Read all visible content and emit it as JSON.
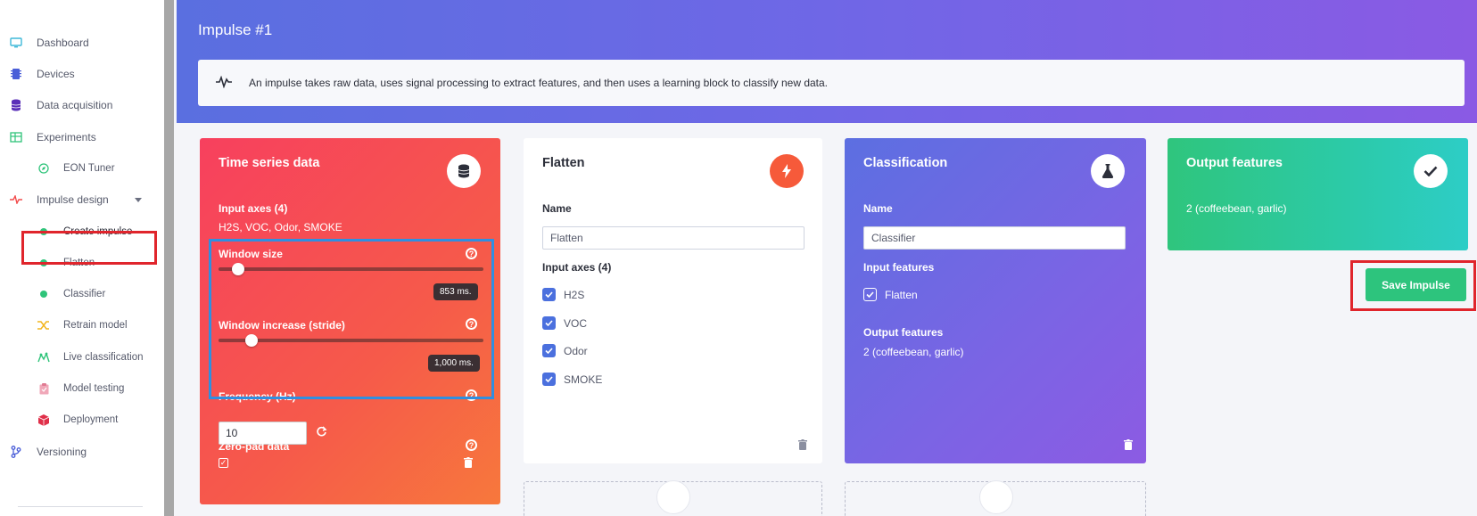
{
  "sidebar": {
    "items": [
      {
        "label": "Dashboard",
        "icon": "monitor-icon"
      },
      {
        "label": "Devices",
        "icon": "chip-icon"
      },
      {
        "label": "Data acquisition",
        "icon": "database-icon"
      },
      {
        "label": "Experiments",
        "icon": "table-icon"
      },
      {
        "label": "EON Tuner",
        "icon": "compass-icon"
      },
      {
        "label": "Impulse design",
        "icon": "pulse-icon"
      },
      {
        "label": "Create impulse",
        "icon": "dot-icon"
      },
      {
        "label": "Flatten",
        "icon": "dot-icon"
      },
      {
        "label": "Classifier",
        "icon": "dot-icon"
      },
      {
        "label": "Retrain model",
        "icon": "shuffle-icon"
      },
      {
        "label": "Live classification",
        "icon": "live-icon"
      },
      {
        "label": "Model testing",
        "icon": "clipboard-icon"
      },
      {
        "label": "Deployment",
        "icon": "cube-icon"
      },
      {
        "label": "Versioning",
        "icon": "branch-icon"
      }
    ]
  },
  "header": {
    "title": "Impulse #1",
    "info": "An impulse takes raw data, uses signal processing to extract features, and then uses a learning block to classify new data."
  },
  "time_series": {
    "title": "Time series data",
    "input_axes_label": "Input axes (4)",
    "input_axes_value": "H2S, VOC, Odor, SMOKE",
    "window_size_label": "Window size",
    "window_size_value": "853 ms.",
    "window_size_fraction": 0.05,
    "stride_label": "Window increase (stride)",
    "stride_value": "1,000 ms.",
    "stride_fraction": 0.1,
    "frequency_label": "Frequency (Hz)",
    "frequency_value": "10",
    "zero_pad_label": "Zero-pad data"
  },
  "flatten": {
    "title": "Flatten",
    "name_label": "Name",
    "name_value": "Flatten",
    "input_axes_label": "Input axes (4)",
    "axes": [
      "H2S",
      "VOC",
      "Odor",
      "SMOKE"
    ]
  },
  "classification": {
    "title": "Classification",
    "name_label": "Name",
    "name_value": "Classifier",
    "input_features_label": "Input features",
    "input_feature": "Flatten",
    "output_features_label": "Output features",
    "output_features_value": "2 (coffeebean, garlic)"
  },
  "output": {
    "title": "Output features",
    "value": "2 (coffeebean, garlic)",
    "save_label": "Save Impulse"
  },
  "colors": {
    "accent_green": "#2dc47d",
    "highlight_red": "#e0252c",
    "highlight_blue": "#2f8fe0"
  }
}
